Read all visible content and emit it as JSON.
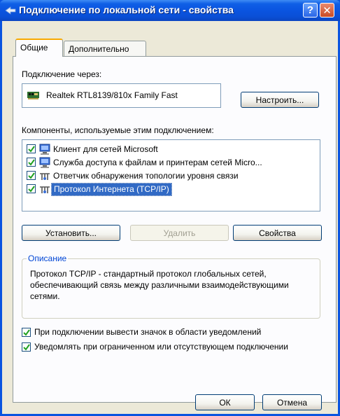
{
  "window": {
    "title": "Подключение по локальной сети - свойства",
    "help_label": "?",
    "close_label": "✕"
  },
  "tabs": [
    {
      "label": "Общие",
      "active": true
    },
    {
      "label": "Дополнительно",
      "active": false
    }
  ],
  "connection": {
    "label": "Подключение через:",
    "adapter_name": "Realtek RTL8139/810x Family Fast",
    "configure_button": "Настроить..."
  },
  "components": {
    "label": "Компоненты, используемые этим подключением:",
    "items": [
      {
        "label": "Клиент для сетей Microsoft",
        "checked": true,
        "icon": "network-client-icon",
        "selected": false
      },
      {
        "label": "Служба доступа к файлам и принтерам сетей Micro...",
        "checked": true,
        "icon": "file-printer-service-icon",
        "selected": false
      },
      {
        "label": "Ответчик обнаружения топологии уровня связи",
        "checked": true,
        "icon": "protocol-icon",
        "selected": false
      },
      {
        "label": "Протокол Интернета (TCP/IP)",
        "checked": true,
        "icon": "protocol-icon",
        "selected": true
      }
    ]
  },
  "actions": {
    "install": "Установить...",
    "remove": "Удалить",
    "properties": "Свойства"
  },
  "description": {
    "title": "Описание",
    "text": "Протокол TCP/IP - стандартный протокол глобальных сетей, обеспечивающий связь между различными взаимодействующими сетями."
  },
  "options": [
    {
      "label": "При подключении вывести значок в области уведомлений",
      "checked": true
    },
    {
      "label": "Уведомлять при ограниченном или отсутствующем подключении",
      "checked": true
    }
  ],
  "footer": {
    "ok": "ОК",
    "cancel": "Отмена"
  },
  "colors": {
    "titlebar": "#0a54e0",
    "selection": "#316ac5",
    "group_title": "#0046d5",
    "active_tab_accent": "#f8a800"
  }
}
